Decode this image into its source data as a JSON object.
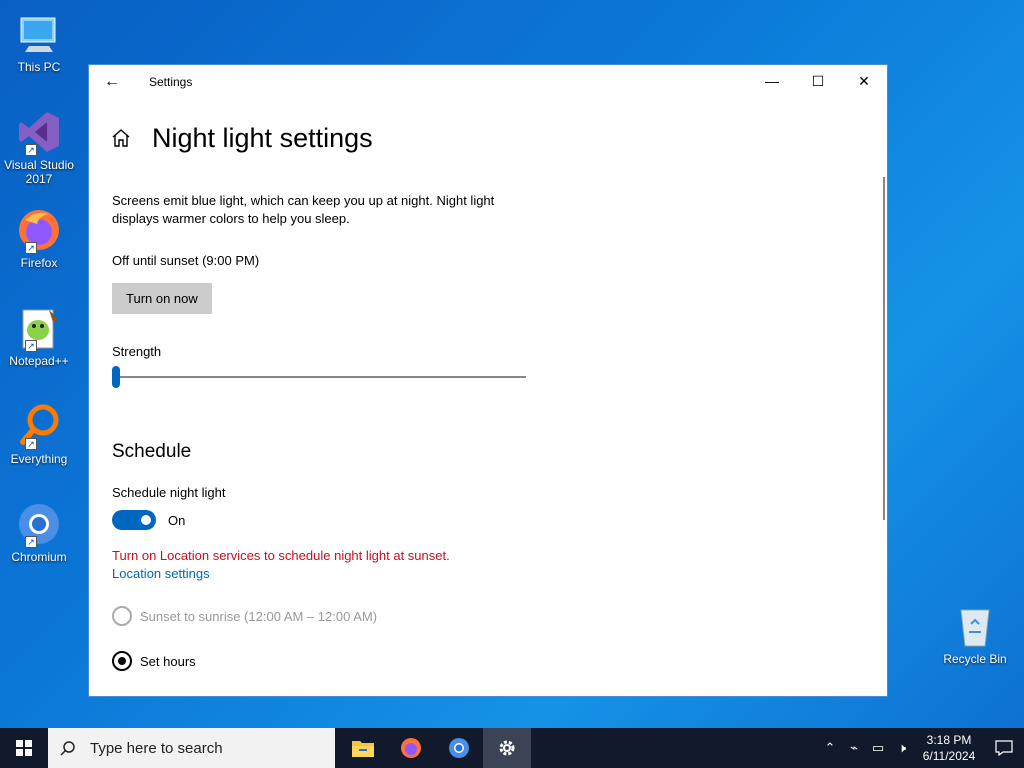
{
  "desktop": {
    "icons": [
      {
        "label": "This PC"
      },
      {
        "label": "Visual Studio 2017"
      },
      {
        "label": "Firefox"
      },
      {
        "label": "Notepad++"
      },
      {
        "label": "Everything"
      },
      {
        "label": "Chromium"
      },
      {
        "label": "Recycle Bin"
      }
    ]
  },
  "window": {
    "title": "Settings",
    "controls": {
      "minimize": "—",
      "maximize": "☐",
      "close": "✕"
    }
  },
  "page": {
    "title": "Night light settings",
    "description": "Screens emit blue light, which can keep you up at night. Night light displays warmer colors to help you sleep.",
    "status": "Off until sunset (9:00 PM)",
    "turn_on_button": "Turn on now",
    "strength_label": "Strength",
    "strength_value": 0,
    "schedule_heading": "Schedule",
    "schedule_label": "Schedule night light",
    "schedule_toggle_state": "On",
    "warning": "Turn on Location services to schedule night light at sunset.",
    "location_link": "Location settings",
    "radio_sunset": "Sunset to sunrise (12:00 AM – 12:00 AM)",
    "radio_set_hours": "Set hours"
  },
  "taskbar": {
    "search_placeholder": "Type here to search",
    "time": "3:18 PM",
    "date": "6/11/2024"
  },
  "colors": {
    "accent": "#0067c0",
    "warning": "#c50f1f",
    "link": "#0067b8"
  }
}
